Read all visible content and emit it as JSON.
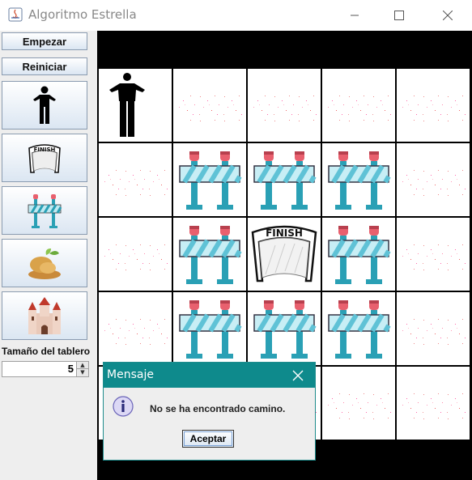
{
  "window": {
    "title": "Algoritmo Estrella"
  },
  "sidebar": {
    "start_label": "Empezar",
    "reset_label": "Reiniciar",
    "tools": [
      {
        "name": "person-icon"
      },
      {
        "name": "finish-flag-icon"
      },
      {
        "name": "barrier-icon"
      },
      {
        "name": "food-icon"
      },
      {
        "name": "castle-icon"
      }
    ],
    "board_size_label": "Tamaño del tablero",
    "board_size_value": "5"
  },
  "board": {
    "size": 5,
    "cells": [
      [
        "person",
        "empty",
        "empty",
        "empty",
        "empty"
      ],
      [
        "empty",
        "barrier",
        "barrier",
        "barrier",
        "empty"
      ],
      [
        "empty",
        "barrier",
        "finish",
        "barrier",
        "empty"
      ],
      [
        "empty",
        "barrier",
        "barrier",
        "barrier",
        "empty"
      ],
      [
        "empty",
        "empty",
        "empty",
        "empty",
        "empty"
      ]
    ]
  },
  "dialog": {
    "title": "Mensaje",
    "message": "No se ha encontrado camino.",
    "ok_label": "Aceptar",
    "icon": "info-icon"
  },
  "colors": {
    "dialog_title_bg": "#0e8a8c",
    "barrier_stripe": "#7fd0e0",
    "barrier_post": "#2aa0b5",
    "barrier_light": "#e8606e"
  }
}
